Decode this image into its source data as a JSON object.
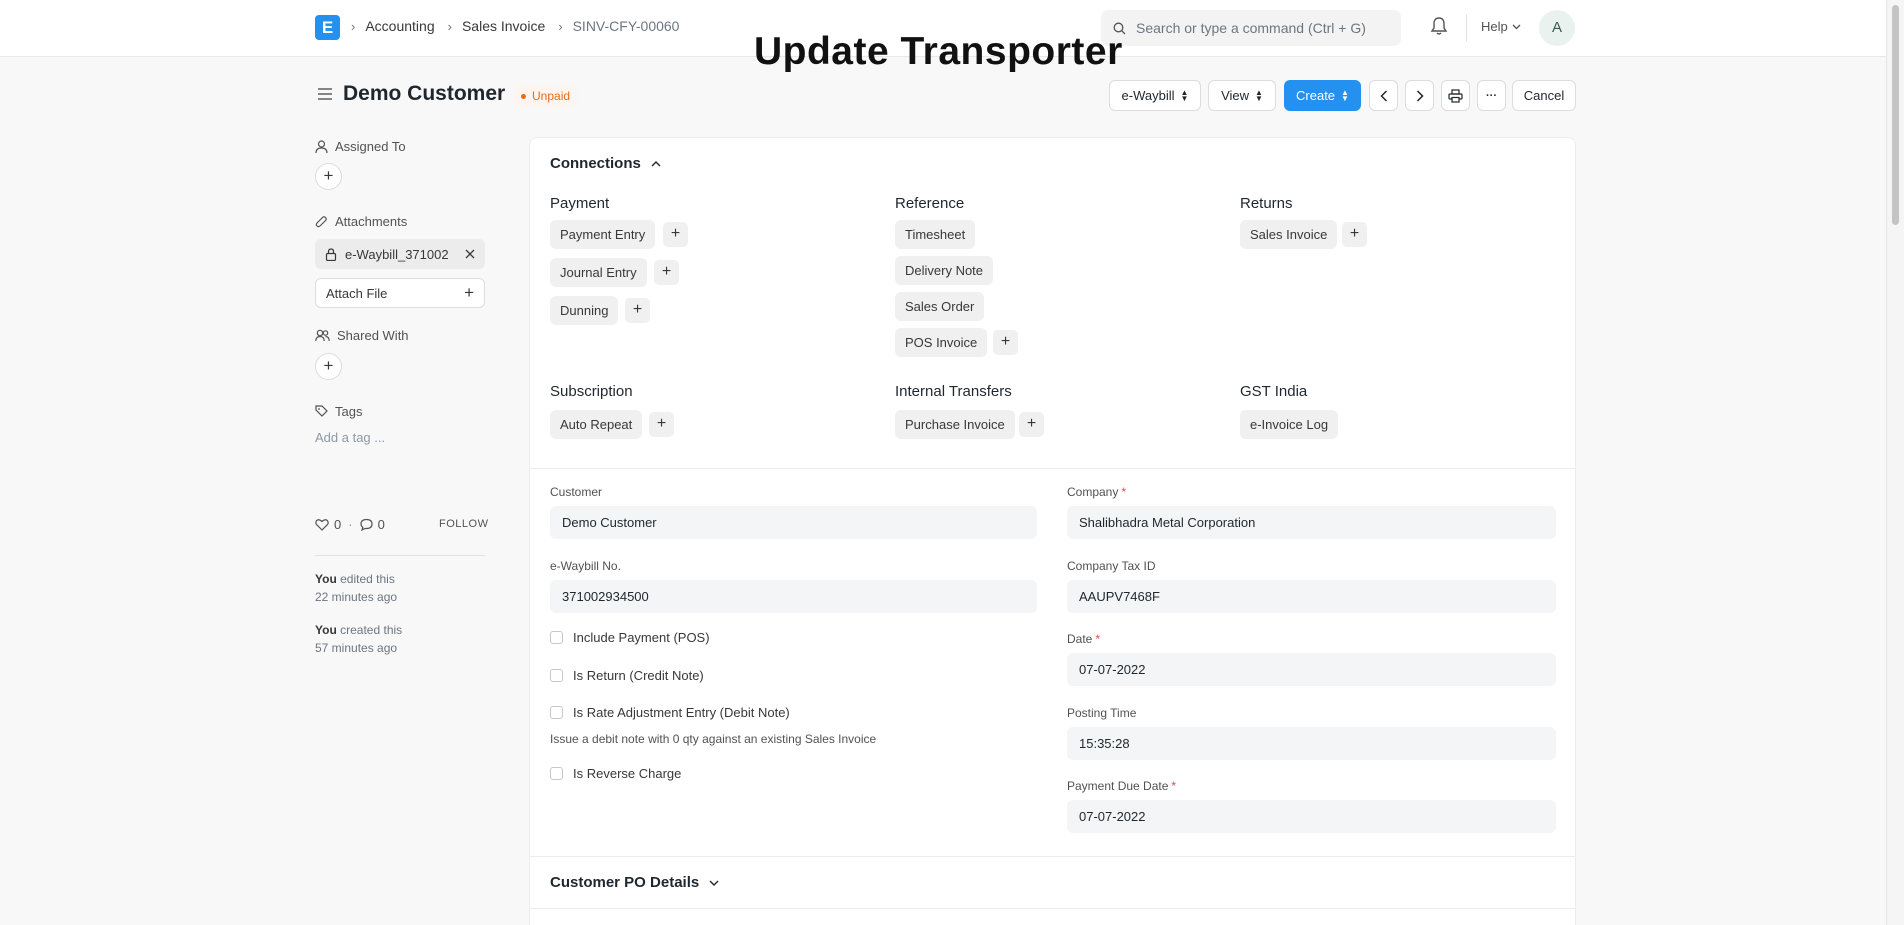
{
  "navbar": {
    "logo": "E",
    "breadcrumbs": [
      "Accounting",
      "Sales Invoice",
      "SINV-CFY-00060"
    ],
    "search_placeholder": "Search or type a command (Ctrl + G)",
    "help_label": "Help",
    "avatar_initial": "A"
  },
  "overlay_title": "Update Transporter",
  "page": {
    "title": "Demo Customer",
    "status": "Unpaid",
    "buttons": {
      "ewaybill": "e-Waybill",
      "view": "View",
      "create": "Create",
      "more": "···",
      "cancel": "Cancel"
    }
  },
  "sidebar": {
    "assigned_to": "Assigned To",
    "attachments": "Attachments",
    "attachment_name": "e-Waybill_371002",
    "attach_file": "Attach File",
    "shared_with": "Shared With",
    "tags": "Tags",
    "add_tag": "Add a tag ...",
    "likes": "0",
    "comments": "0",
    "dot": "·",
    "follow": "FOLLOW",
    "activity": [
      {
        "who": "You",
        "what": "edited this",
        "when": "22 minutes ago"
      },
      {
        "who": "You",
        "what": "created this",
        "when": "57 minutes ago"
      }
    ]
  },
  "connections": {
    "title": "Connections",
    "groups": {
      "payment": {
        "title": "Payment",
        "items": [
          "Payment Entry",
          "Journal Entry",
          "Dunning"
        ]
      },
      "reference": {
        "title": "Reference",
        "items": [
          "Timesheet",
          "Delivery Note",
          "Sales Order",
          "POS Invoice"
        ]
      },
      "returns": {
        "title": "Returns",
        "items": [
          "Sales Invoice"
        ]
      },
      "subscription": {
        "title": "Subscription",
        "items": [
          "Auto Repeat"
        ]
      },
      "internal": {
        "title": "Internal Transfers",
        "items": [
          "Purchase Invoice"
        ]
      },
      "gst": {
        "title": "GST India",
        "items": [
          "e-Invoice Log"
        ]
      }
    }
  },
  "form": {
    "customer": {
      "label": "Customer",
      "value": "Demo Customer"
    },
    "ewaybill_no": {
      "label": "e-Waybill No.",
      "value": "371002934500"
    },
    "checks": [
      "Include Payment (POS)",
      "Is Return (Credit Note)",
      "Is Rate Adjustment Entry (Debit Note)",
      "Is Reverse Charge"
    ],
    "hint": "Issue a debit note with 0 qty against an existing Sales Invoice",
    "company": {
      "label": "Company",
      "value": "Shalibhadra Metal Corporation"
    },
    "company_tax_id": {
      "label": "Company Tax ID",
      "value": "AAUPV7468F"
    },
    "date": {
      "label": "Date",
      "value": "07-07-2022"
    },
    "posting_time": {
      "label": "Posting Time",
      "value": "15:35:28"
    },
    "payment_due_date": {
      "label": "Payment Due Date",
      "value": "07-07-2022"
    },
    "required_mark": "*"
  },
  "customer_po": {
    "title": "Customer PO Details"
  }
}
